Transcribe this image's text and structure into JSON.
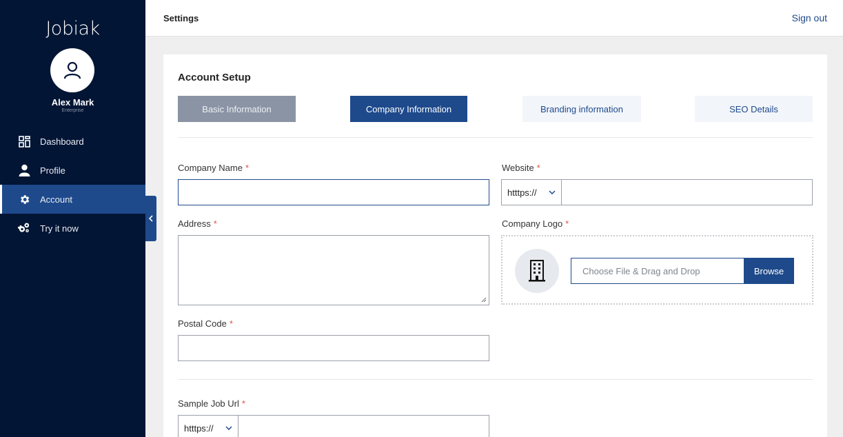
{
  "brand": {
    "logo_text": "Jobiak"
  },
  "user": {
    "name": "Alex Mark",
    "role": "Enterprise"
  },
  "sidebar": {
    "items": [
      {
        "label": "Dashboard",
        "icon": "dashboard-icon"
      },
      {
        "label": "Profile",
        "icon": "user-icon"
      },
      {
        "label": "Account",
        "icon": "gear-icon",
        "active": true
      },
      {
        "label": "Try it now",
        "icon": "gears-icon"
      }
    ]
  },
  "topbar": {
    "title": "Settings",
    "signout_label": "Sign out"
  },
  "card": {
    "title": "Account Setup",
    "tabs": [
      {
        "label": "Basic Information",
        "state": "completed"
      },
      {
        "label": "Company Information",
        "state": "active"
      },
      {
        "label": "Branding information",
        "state": "inactive"
      },
      {
        "label": "SEO Details",
        "state": "inactive"
      }
    ]
  },
  "form": {
    "company_name": {
      "label": "Company Name",
      "required_mark": "*",
      "value": ""
    },
    "website": {
      "label": "Website",
      "required_mark": "*",
      "protocol": "htttps://",
      "value": ""
    },
    "address": {
      "label": "Address",
      "required_mark": "*",
      "value": ""
    },
    "company_logo": {
      "label": "Company Logo",
      "required_mark": "*",
      "placeholder": "Choose File & Drag and Drop",
      "browse_label": "Browse"
    },
    "postal_code": {
      "label": "Postal Code",
      "required_mark": "*",
      "value": ""
    },
    "sample_job_url": {
      "label": "Sample Job Url",
      "required_mark": "*",
      "protocol": "htttps://",
      "value": ""
    }
  },
  "colors": {
    "sidebar_bg": "#031535",
    "accent": "#1e4a8c",
    "required": "#e0533f"
  }
}
